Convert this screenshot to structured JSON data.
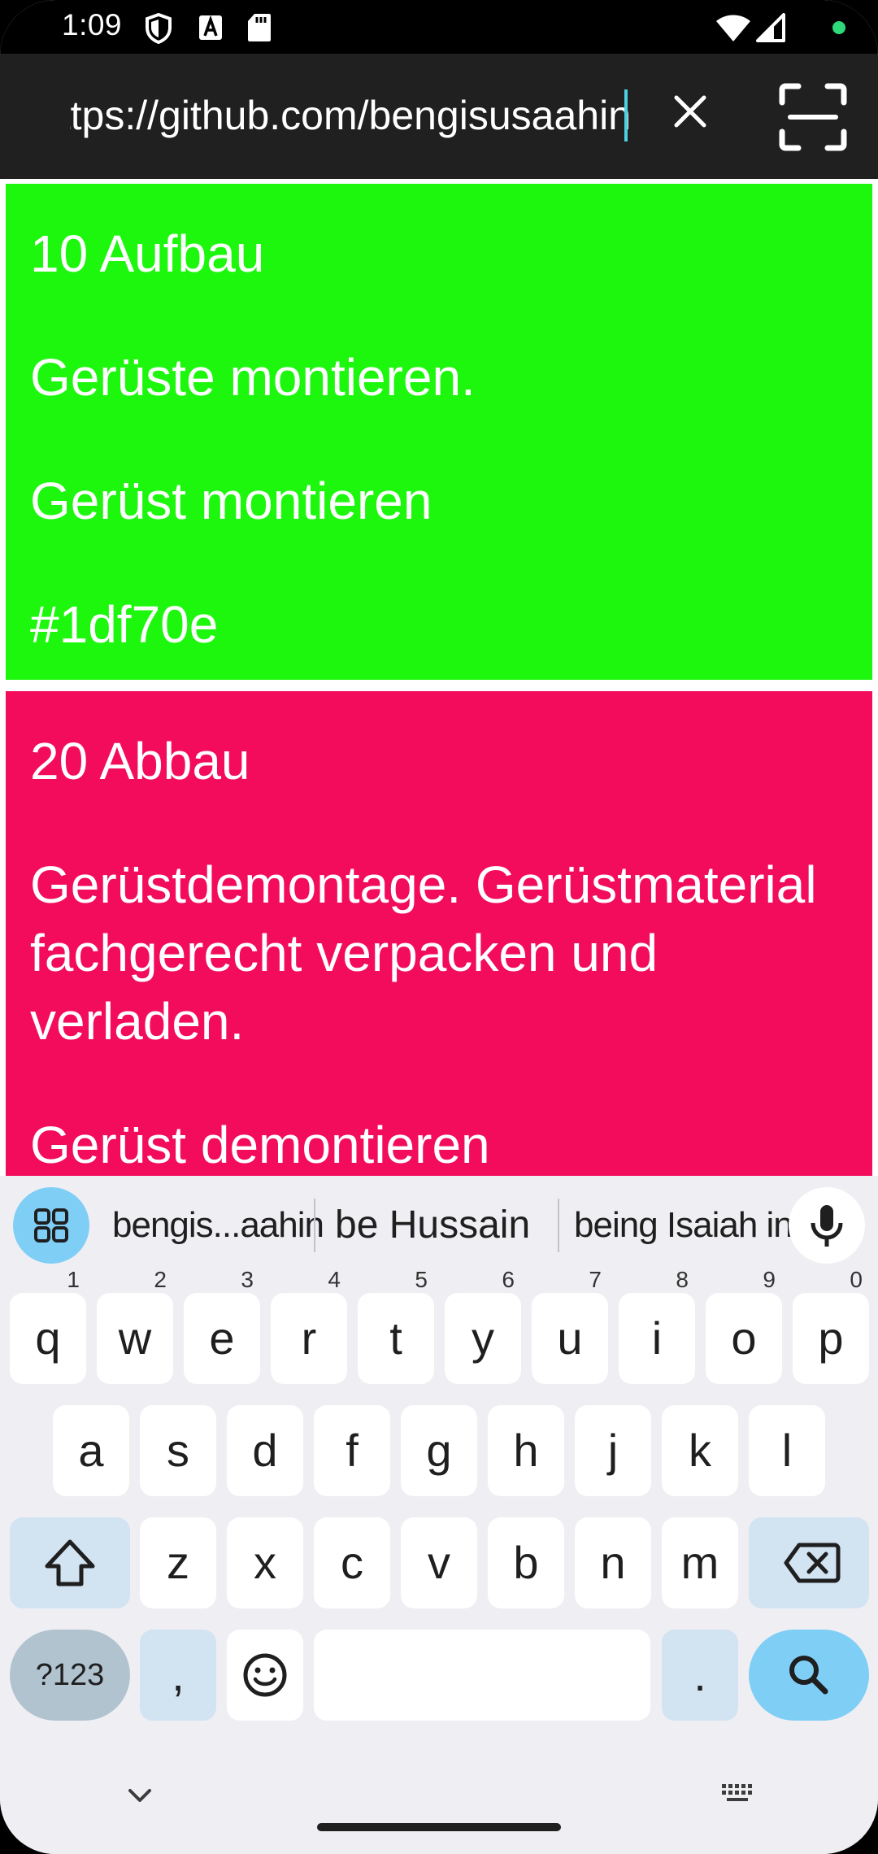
{
  "status_bar": {
    "time": "1:09",
    "icons": [
      "shield-icon",
      "font-a-icon",
      "sd-card-icon",
      "wifi-icon",
      "cellular-signal-icon",
      "green-privacy-dot"
    ]
  },
  "url_bar": {
    "url_value": "https://github.com/bengisusaahin",
    "clear_icon": "close-icon",
    "scan_icon": "scan-icon"
  },
  "cards": [
    {
      "color": "#1df70e",
      "lines": [
        "10 Aufbau",
        "Gerüste montieren.",
        "Gerüst montieren",
        "#1df70e"
      ]
    },
    {
      "color": "#f20c5b",
      "lines": [
        "20 Abbau",
        "Gerüstdemontage. Gerüstmaterial fachgerecht verpacken und verladen.",
        "Gerüst demontieren"
      ]
    }
  ],
  "suggestions": [
    "bengis...aahin",
    "be Hussain",
    "being Isaiah in"
  ],
  "keyboard": {
    "row1": [
      {
        "key": "q",
        "hint": "1"
      },
      {
        "key": "w",
        "hint": "2"
      },
      {
        "key": "e",
        "hint": "3"
      },
      {
        "key": "r",
        "hint": "4"
      },
      {
        "key": "t",
        "hint": "5"
      },
      {
        "key": "y",
        "hint": "6"
      },
      {
        "key": "u",
        "hint": "7"
      },
      {
        "key": "i",
        "hint": "8"
      },
      {
        "key": "o",
        "hint": "9"
      },
      {
        "key": "p",
        "hint": "0"
      }
    ],
    "row2": [
      "a",
      "s",
      "d",
      "f",
      "g",
      "h",
      "j",
      "k",
      "l"
    ],
    "row3": [
      "z",
      "x",
      "c",
      "v",
      "b",
      "n",
      "m"
    ],
    "symbols_label": "?123",
    "comma_label": ",",
    "period_label": ".",
    "shift_icon": "shift-icon",
    "backspace_icon": "backspace-icon",
    "emoji_icon": "emoji-icon",
    "search_icon": "search-icon"
  },
  "nav": {
    "hide_icon": "chevron-down-icon",
    "keyboard_switch_icon": "keyboard-icon"
  }
}
